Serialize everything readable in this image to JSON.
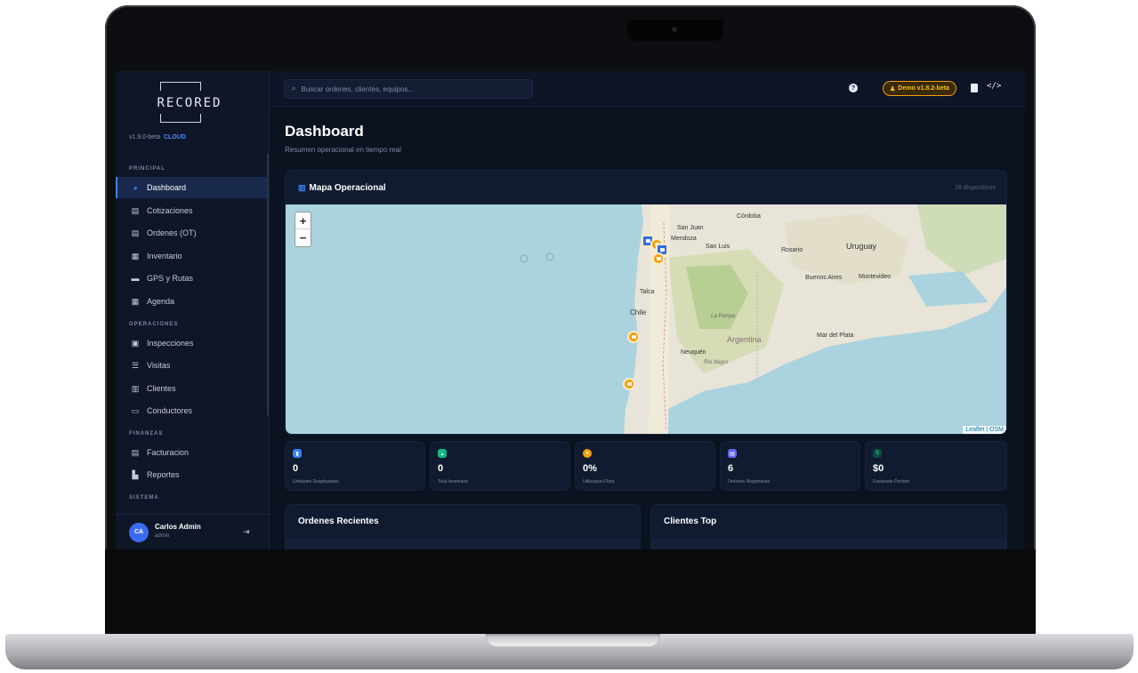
{
  "app": {
    "logo_text": "RECORED",
    "version": "v1.9.0-beta",
    "edition": "CLOUD"
  },
  "search": {
    "placeholder": "Buscar ordenes, clientes, equipos..."
  },
  "topbar": {
    "help_glyph": "?",
    "demo_badge": "Demo v1.8.2-beta",
    "code_glyph": "</>"
  },
  "sidebar": {
    "sections": [
      {
        "label": "PRINCIPAL"
      },
      {
        "label": "OPERACIONES"
      },
      {
        "label": "FINANZAS"
      },
      {
        "label": "SISTEMA"
      }
    ],
    "items": [
      {
        "label": "Dashboard",
        "icon": "dashboard-icon"
      },
      {
        "label": "Cotizaciones",
        "icon": "document-icon"
      },
      {
        "label": "Ordenes (OT)",
        "icon": "document-icon"
      },
      {
        "label": "Inventario",
        "icon": "boxes-icon"
      },
      {
        "label": "GPS y Rutas",
        "icon": "truck-icon"
      },
      {
        "label": "Agenda",
        "icon": "calendar-icon"
      },
      {
        "label": "Inspecciones",
        "icon": "clipboard-icon"
      },
      {
        "label": "Visitas",
        "icon": "list-icon"
      },
      {
        "label": "Clientes",
        "icon": "building-icon"
      },
      {
        "label": "Conductores",
        "icon": "id-card-icon"
      },
      {
        "label": "Facturacion",
        "icon": "invoice-icon"
      },
      {
        "label": "Reportes",
        "icon": "chart-icon"
      }
    ]
  },
  "user": {
    "initials": "CA",
    "name": "Carlos Admin",
    "role": "admin"
  },
  "page": {
    "title": "Dashboard",
    "subtitle": "Resumen operacional en tiempo real"
  },
  "map": {
    "title": "Mapa Operacional",
    "device_count": "28 dispositivos",
    "zoom_in": "+",
    "zoom_out": "−",
    "attribution": "Leaflet | OSM",
    "labels": {
      "cordoba": "Córdoba",
      "san_juan": "San Juan",
      "mendoza": "Mendoza",
      "san_luis": "San Luis",
      "rosario": "Rosario",
      "uruguay": "Uruguay",
      "buenos_aires": "Buenos Aires",
      "montevideo": "Montevideo",
      "talca": "Talca",
      "chile": "Chile",
      "la_pampa": "La Pampa",
      "argentina": "Argentina",
      "mar_del_plata": "Mar del Plata",
      "neuquen": "Neuquén",
      "rio_negro": "Río Negro"
    }
  },
  "stats": [
    {
      "value": "0",
      "label": "Unidades Desplegadas",
      "color": "#3b82f6"
    },
    {
      "value": "0",
      "label": "Total Inventario",
      "color": "#10b981"
    },
    {
      "value": "0%",
      "label": "Utilizacion Flota",
      "color": "#f59e0b"
    },
    {
      "value": "6",
      "label": "Ordenes Registradas",
      "color": "#6366f1"
    },
    {
      "value": "$0",
      "label": "Facturado Periodo",
      "color": "#10b981"
    }
  ],
  "cards": {
    "recent_orders": "Ordenes Recientes",
    "top_clients": "Clientes Top"
  }
}
